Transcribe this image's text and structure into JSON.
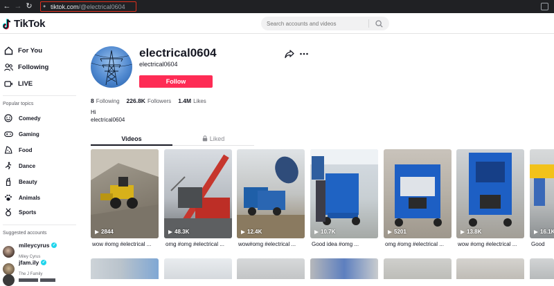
{
  "browser": {
    "url_host": "tiktok.com",
    "url_path": "/@electrical0604"
  },
  "header": {
    "logo_text": "TikTok",
    "search_placeholder": "Search accounts and videos"
  },
  "sidebar": {
    "nav": [
      {
        "label": "For You",
        "icon": "home-icon"
      },
      {
        "label": "Following",
        "icon": "following-icon"
      },
      {
        "label": "LIVE",
        "icon": "live-icon"
      }
    ],
    "topics_heading": "Popular topics",
    "topics": [
      {
        "label": "Comedy",
        "icon": "comedy-icon"
      },
      {
        "label": "Gaming",
        "icon": "gaming-icon"
      },
      {
        "label": "Food",
        "icon": "food-icon"
      },
      {
        "label": "Dance",
        "icon": "dance-icon"
      },
      {
        "label": "Beauty",
        "icon": "beauty-icon"
      },
      {
        "label": "Animals",
        "icon": "animals-icon"
      },
      {
        "label": "Sports",
        "icon": "sports-icon"
      }
    ],
    "suggested_heading": "Suggested accounts",
    "accounts": [
      {
        "name": "mileycyrus",
        "sub": "Miley Cyrus",
        "verified": true
      },
      {
        "name": "jfam.ily",
        "sub": "The J Family",
        "verified": true
      },
      {
        "name": "",
        "sub": "",
        "verified": false
      }
    ]
  },
  "profile": {
    "username": "electrical0604",
    "handle": "electrical0604",
    "follow_label": "Follow",
    "stats": [
      {
        "value": "8",
        "label": "Following"
      },
      {
        "value": "226.8K",
        "label": "Followers"
      },
      {
        "value": "1.4M",
        "label": "Likes"
      }
    ],
    "bio_line1": "Hi",
    "bio_line2": "electrical0604"
  },
  "tabs": [
    {
      "label": "Videos",
      "active": true
    },
    {
      "label": "Liked",
      "active": false
    }
  ],
  "videos": [
    {
      "views": "2844",
      "caption": "wow #omg #electrical ..."
    },
    {
      "views": "48.3K",
      "caption": "omg #omg #electrical ..."
    },
    {
      "views": "12.4K",
      "caption": "wow#omg #electrical ..."
    },
    {
      "views": "10.7K",
      "caption": "Good idea #omg ..."
    },
    {
      "views": "5201",
      "caption": "omg #omg #electrical ..."
    },
    {
      "views": "13.8K",
      "caption": "wow #omg #electrical ..."
    },
    {
      "views": "16.1K",
      "caption": "Good"
    }
  ],
  "colors": {
    "brand_red": "#fe2c55",
    "verified": "#20d5ec",
    "text": "#161823"
  }
}
